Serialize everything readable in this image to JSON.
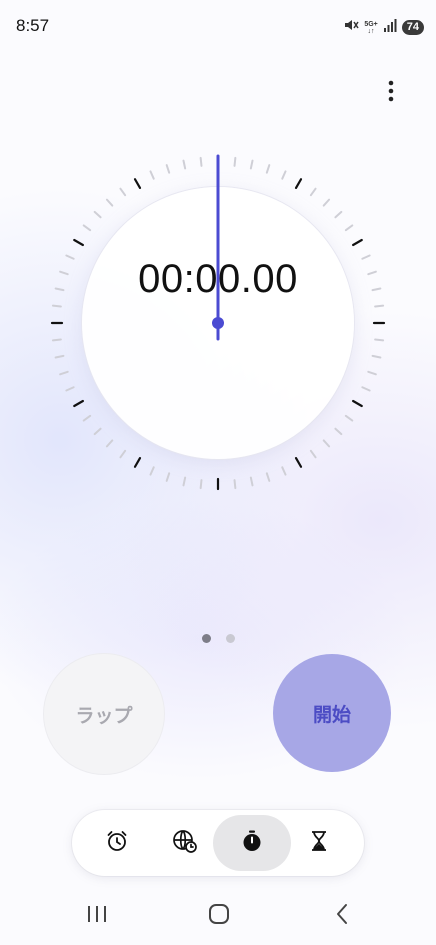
{
  "status_bar": {
    "time": "8:57",
    "network_top": "5G+",
    "network_bottom": "↓↑",
    "battery": "74",
    "icons": [
      "mute-icon",
      "signal-icon",
      "battery-icon"
    ]
  },
  "stopwatch": {
    "display": "00:00.00",
    "accent_color": "#4b4bd2"
  },
  "pager": {
    "pages": 2,
    "active_index": 0
  },
  "buttons": {
    "lap_label": "ラップ",
    "start_label": "開始"
  },
  "tabs": [
    {
      "icon": "alarm-icon",
      "selected": false
    },
    {
      "icon": "world-clock-icon",
      "selected": false
    },
    {
      "icon": "stopwatch-icon",
      "selected": true
    },
    {
      "icon": "timer-icon",
      "selected": false
    }
  ],
  "nav": {
    "icons": [
      "recent-apps-icon",
      "home-icon",
      "back-icon"
    ]
  }
}
